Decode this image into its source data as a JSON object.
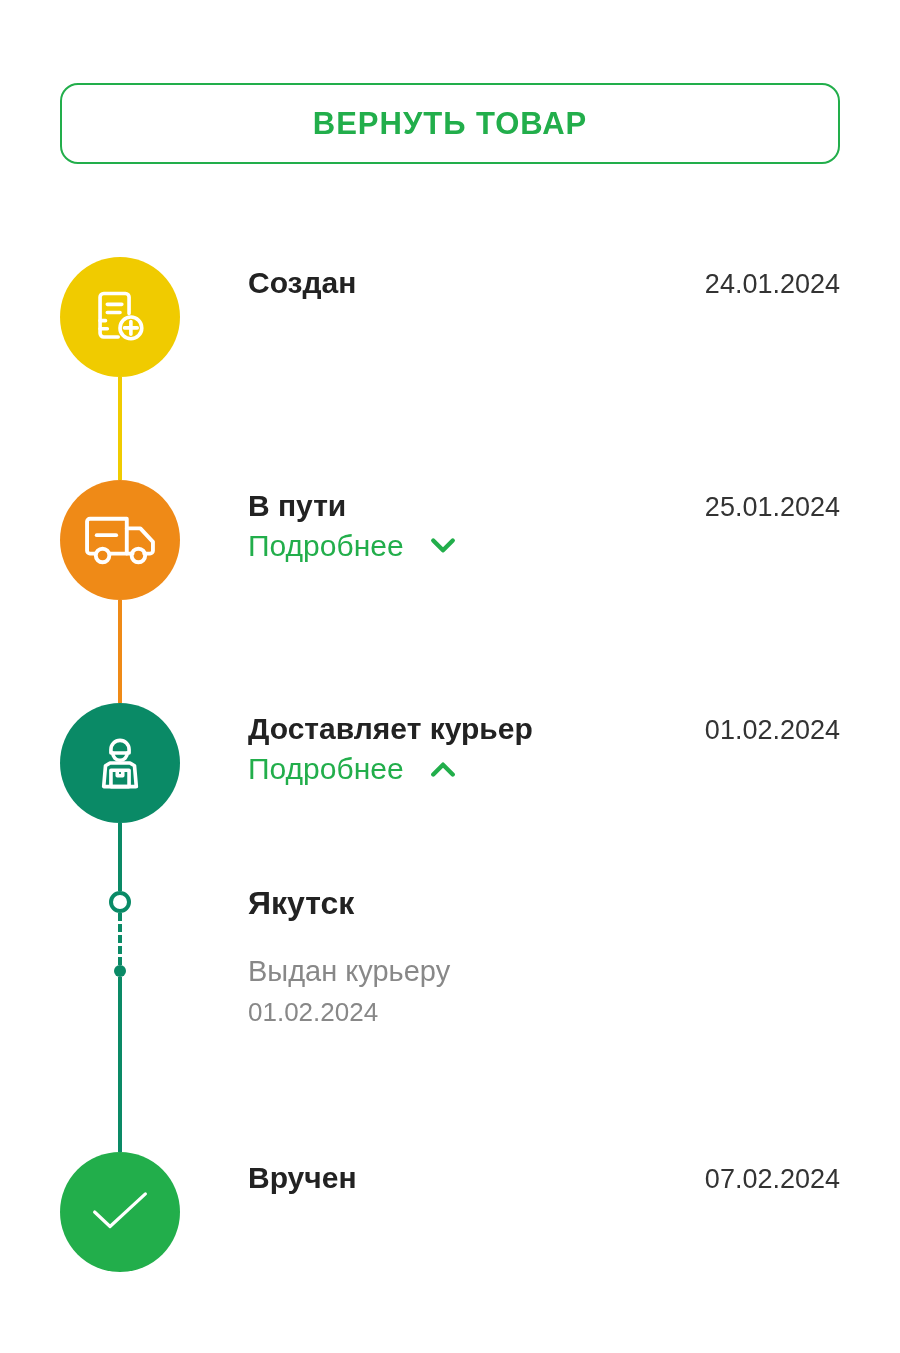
{
  "return_button": {
    "label": "ВЕРНУТЬ ТОВАР"
  },
  "steps": [
    {
      "kind": "created",
      "color": "#f0cb00",
      "title": "Создан",
      "date": "24.01.2024"
    },
    {
      "kind": "transit",
      "color": "#ef8a17",
      "title": "В пути",
      "date": "25.01.2024",
      "details": {
        "label": "Подробнее",
        "expanded": false
      }
    },
    {
      "kind": "courier",
      "color": "#0a8a66",
      "title": "Доставляет курьер",
      "date": "01.02.2024",
      "details": {
        "label": "Подробнее",
        "expanded": true
      },
      "events": [
        {
          "city": "Якутск",
          "status": "Выдан курьеру",
          "date": "01.02.2024"
        }
      ]
    },
    {
      "kind": "delivered",
      "color": "#22ae4b",
      "title": "Вручен",
      "date": "07.02.2024"
    }
  ]
}
